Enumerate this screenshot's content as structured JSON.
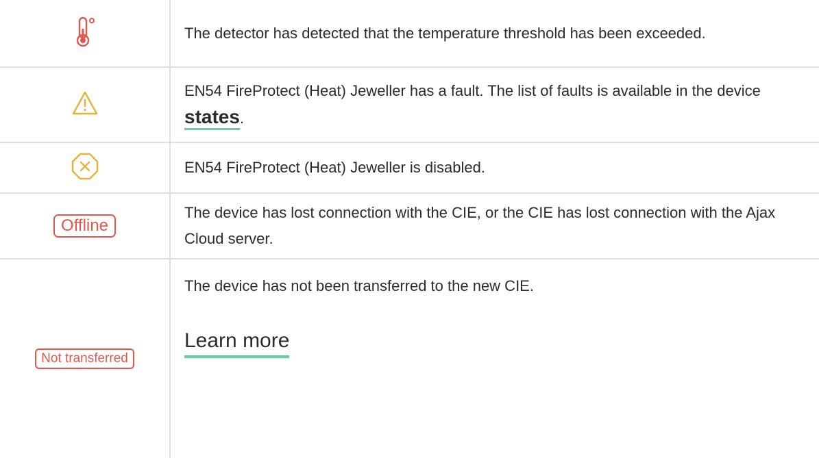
{
  "colors": {
    "red": "#e2574c",
    "amber": "#e8b23a",
    "link_underline": "#5ad3a1",
    "grid": "#dedede",
    "text": "#2b2b2b"
  },
  "rows": [
    {
      "icon": "thermometer-icon",
      "text": "The detector has detected that the temperature threshold has been exceeded."
    },
    {
      "icon": "warning-triangle-icon",
      "text_before": "EN54 FireProtect (Heat) Jeweller has a fault. The list of faults is available in the device ",
      "link_label": "states",
      "text_after": "."
    },
    {
      "icon": "disabled-octagon-icon",
      "text": "EN54 FireProtect (Heat) Jeweller is disabled."
    },
    {
      "badge": "Offline",
      "text": "The device has lost connection with the CIE, or the CIE has lost connection with the Ajax Cloud server."
    },
    {
      "badge": "Not transferred",
      "text": "The device has not been transferred to the new CIE.",
      "link_label": "Learn more"
    }
  ]
}
